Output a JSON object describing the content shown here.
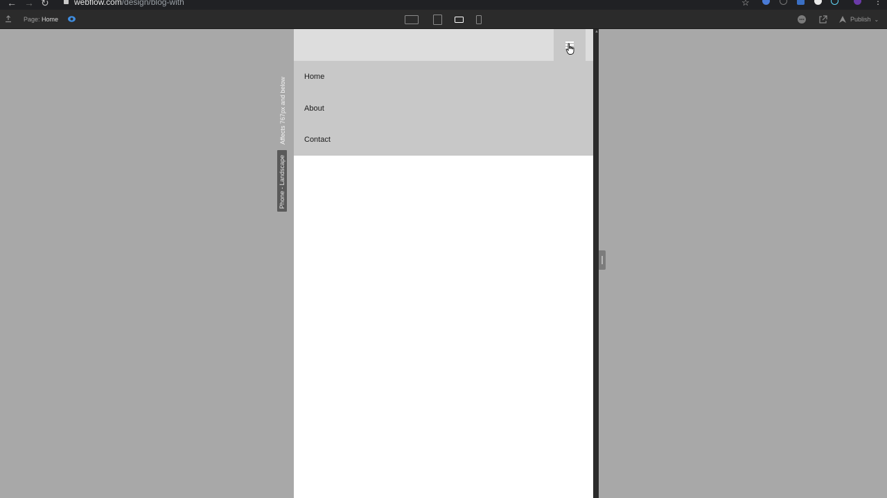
{
  "browser": {
    "url_host": "webflow.com",
    "url_path": "/design/blog-with"
  },
  "toolbar": {
    "page_prefix": "Page:",
    "page_name": "Home",
    "publish_label": "Publish",
    "breakpoints": [
      {
        "name": "desktop",
        "active": false
      },
      {
        "name": "tablet",
        "active": false
      },
      {
        "name": "phone-landscape",
        "active": true
      },
      {
        "name": "phone-portrait",
        "active": false
      }
    ]
  },
  "canvas": {
    "breakpoint_note": "Affects 767px and below",
    "breakpoint_badge": "Phone - Landscape"
  },
  "site": {
    "nav_links": [
      "Home",
      "About",
      "Contact"
    ]
  },
  "icons": {
    "upload": "upload-icon",
    "preview": "eye-icon",
    "comments": "comment-icon",
    "share": "share-icon",
    "publish": "publish-icon",
    "menu": "hamburger-icon",
    "cursor": "pointer-cursor-icon"
  },
  "colors": {
    "toolbar_bg": "#2b2b2b",
    "canvas_bg": "#a8a8a8",
    "navbar_bg": "#dddddd",
    "menu_bg": "#c8c8c8",
    "accent": "#4a90e2"
  }
}
